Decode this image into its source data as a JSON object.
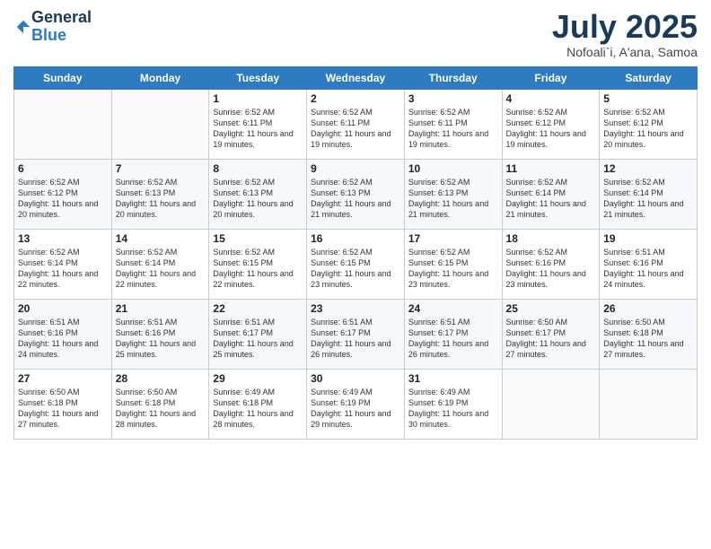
{
  "logo": {
    "general": "General",
    "blue": "Blue"
  },
  "header": {
    "month": "July 2025",
    "location": "Nofoali`i, A'ana, Samoa"
  },
  "weekdays": [
    "Sunday",
    "Monday",
    "Tuesday",
    "Wednesday",
    "Thursday",
    "Friday",
    "Saturday"
  ],
  "weeks": [
    [
      {
        "day": "",
        "info": ""
      },
      {
        "day": "",
        "info": ""
      },
      {
        "day": "1",
        "info": "Sunrise: 6:52 AM\nSunset: 6:11 PM\nDaylight: 11 hours and 19 minutes."
      },
      {
        "day": "2",
        "info": "Sunrise: 6:52 AM\nSunset: 6:11 PM\nDaylight: 11 hours and 19 minutes."
      },
      {
        "day": "3",
        "info": "Sunrise: 6:52 AM\nSunset: 6:11 PM\nDaylight: 11 hours and 19 minutes."
      },
      {
        "day": "4",
        "info": "Sunrise: 6:52 AM\nSunset: 6:12 PM\nDaylight: 11 hours and 19 minutes."
      },
      {
        "day": "5",
        "info": "Sunrise: 6:52 AM\nSunset: 6:12 PM\nDaylight: 11 hours and 20 minutes."
      }
    ],
    [
      {
        "day": "6",
        "info": "Sunrise: 6:52 AM\nSunset: 6:12 PM\nDaylight: 11 hours and 20 minutes."
      },
      {
        "day": "7",
        "info": "Sunrise: 6:52 AM\nSunset: 6:13 PM\nDaylight: 11 hours and 20 minutes."
      },
      {
        "day": "8",
        "info": "Sunrise: 6:52 AM\nSunset: 6:13 PM\nDaylight: 11 hours and 20 minutes."
      },
      {
        "day": "9",
        "info": "Sunrise: 6:52 AM\nSunset: 6:13 PM\nDaylight: 11 hours and 21 minutes."
      },
      {
        "day": "10",
        "info": "Sunrise: 6:52 AM\nSunset: 6:13 PM\nDaylight: 11 hours and 21 minutes."
      },
      {
        "day": "11",
        "info": "Sunrise: 6:52 AM\nSunset: 6:14 PM\nDaylight: 11 hours and 21 minutes."
      },
      {
        "day": "12",
        "info": "Sunrise: 6:52 AM\nSunset: 6:14 PM\nDaylight: 11 hours and 21 minutes."
      }
    ],
    [
      {
        "day": "13",
        "info": "Sunrise: 6:52 AM\nSunset: 6:14 PM\nDaylight: 11 hours and 22 minutes."
      },
      {
        "day": "14",
        "info": "Sunrise: 6:52 AM\nSunset: 6:14 PM\nDaylight: 11 hours and 22 minutes."
      },
      {
        "day": "15",
        "info": "Sunrise: 6:52 AM\nSunset: 6:15 PM\nDaylight: 11 hours and 22 minutes."
      },
      {
        "day": "16",
        "info": "Sunrise: 6:52 AM\nSunset: 6:15 PM\nDaylight: 11 hours and 23 minutes."
      },
      {
        "day": "17",
        "info": "Sunrise: 6:52 AM\nSunset: 6:15 PM\nDaylight: 11 hours and 23 minutes."
      },
      {
        "day": "18",
        "info": "Sunrise: 6:52 AM\nSunset: 6:16 PM\nDaylight: 11 hours and 23 minutes."
      },
      {
        "day": "19",
        "info": "Sunrise: 6:51 AM\nSunset: 6:16 PM\nDaylight: 11 hours and 24 minutes."
      }
    ],
    [
      {
        "day": "20",
        "info": "Sunrise: 6:51 AM\nSunset: 6:16 PM\nDaylight: 11 hours and 24 minutes."
      },
      {
        "day": "21",
        "info": "Sunrise: 6:51 AM\nSunset: 6:16 PM\nDaylight: 11 hours and 25 minutes."
      },
      {
        "day": "22",
        "info": "Sunrise: 6:51 AM\nSunset: 6:17 PM\nDaylight: 11 hours and 25 minutes."
      },
      {
        "day": "23",
        "info": "Sunrise: 6:51 AM\nSunset: 6:17 PM\nDaylight: 11 hours and 26 minutes."
      },
      {
        "day": "24",
        "info": "Sunrise: 6:51 AM\nSunset: 6:17 PM\nDaylight: 11 hours and 26 minutes."
      },
      {
        "day": "25",
        "info": "Sunrise: 6:50 AM\nSunset: 6:17 PM\nDaylight: 11 hours and 27 minutes."
      },
      {
        "day": "26",
        "info": "Sunrise: 6:50 AM\nSunset: 6:18 PM\nDaylight: 11 hours and 27 minutes."
      }
    ],
    [
      {
        "day": "27",
        "info": "Sunrise: 6:50 AM\nSunset: 6:18 PM\nDaylight: 11 hours and 27 minutes."
      },
      {
        "day": "28",
        "info": "Sunrise: 6:50 AM\nSunset: 6:18 PM\nDaylight: 11 hours and 28 minutes."
      },
      {
        "day": "29",
        "info": "Sunrise: 6:49 AM\nSunset: 6:18 PM\nDaylight: 11 hours and 28 minutes."
      },
      {
        "day": "30",
        "info": "Sunrise: 6:49 AM\nSunset: 6:19 PM\nDaylight: 11 hours and 29 minutes."
      },
      {
        "day": "31",
        "info": "Sunrise: 6:49 AM\nSunset: 6:19 PM\nDaylight: 11 hours and 30 minutes."
      },
      {
        "day": "",
        "info": ""
      },
      {
        "day": "",
        "info": ""
      }
    ]
  ]
}
